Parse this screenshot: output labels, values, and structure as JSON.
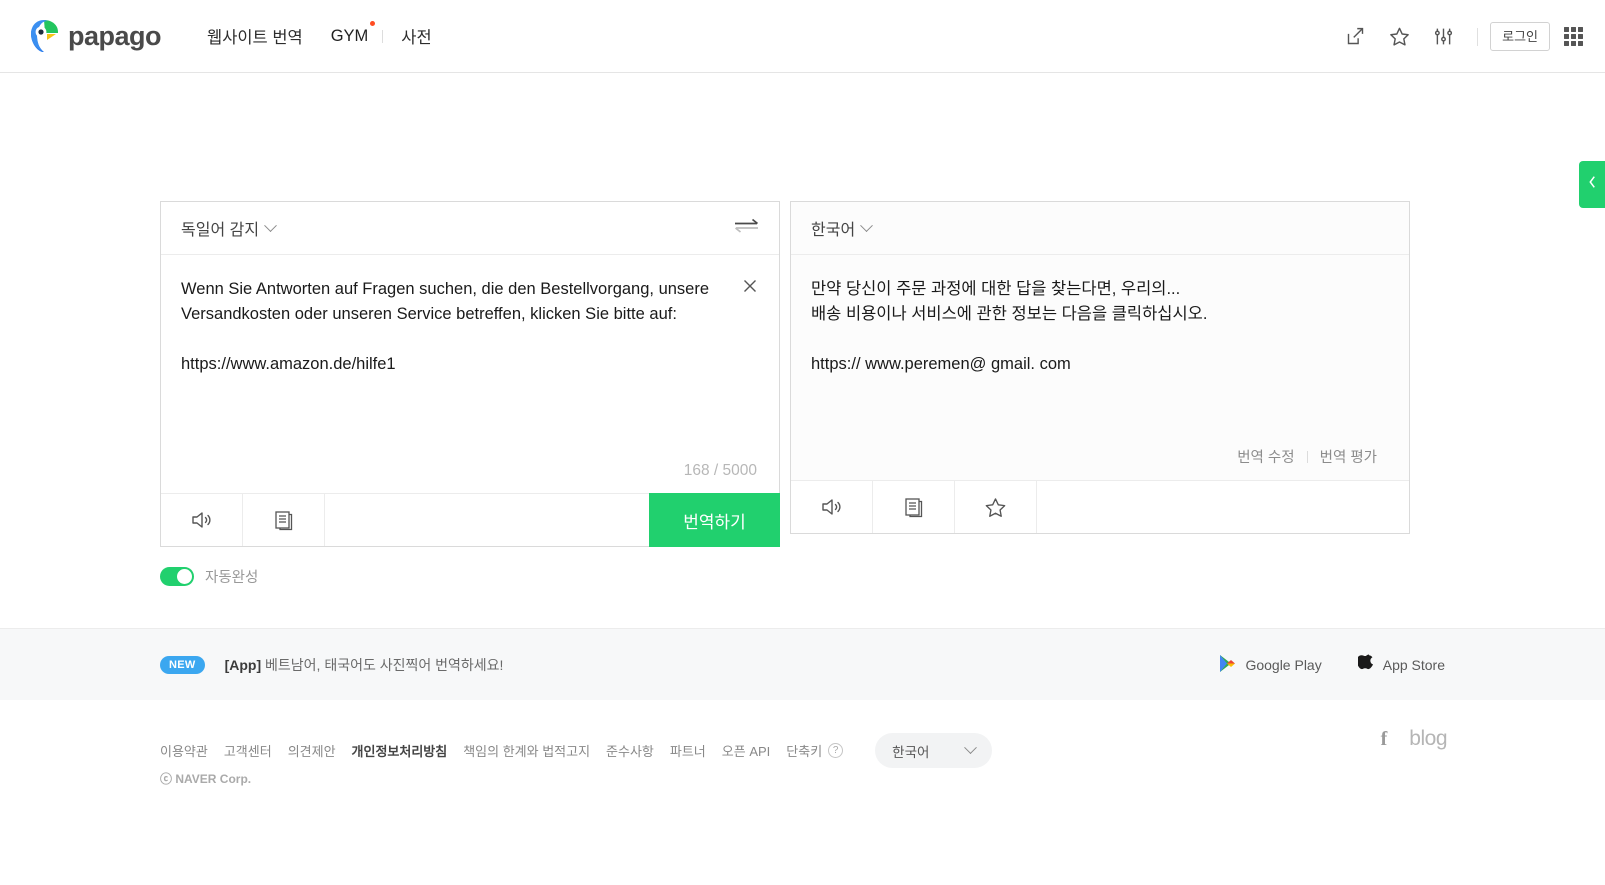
{
  "header": {
    "logo_text": "papago",
    "logo_icon": "papago-parrot-logo",
    "nav": [
      {
        "label": "웹사이트 번역",
        "name": "website-translate"
      },
      {
        "label": "GYM",
        "name": "gym"
      },
      {
        "label": "사전",
        "name": "dictionary"
      }
    ],
    "icons": [
      {
        "name": "share-icon"
      },
      {
        "name": "star-icon"
      },
      {
        "name": "settings-sliders-icon"
      }
    ],
    "login_label": "로그인",
    "apps_icon": "app-grid-icon"
  },
  "side_tab": {
    "icon": "chevron-left-icon",
    "color": "#21d06e"
  },
  "source_panel": {
    "language": "독일어 감지",
    "chevron_icon": "chevron-down-icon",
    "swap_icon": "swap-languages-icon",
    "clear_icon": "close-icon",
    "text": "Wenn Sie Antworten auf Fragen suchen, die den Bestellvorgang, unsere\nVersandkosten oder unseren Service betreffen, klicken Sie bitte auf:\n\nhttps://www.amazon.de/hilfe1",
    "counter": "168 / 5000",
    "char_count": 168,
    "char_limit": 5000,
    "tools": [
      {
        "name": "listen-icon"
      },
      {
        "name": "copy-icon"
      }
    ],
    "translate_label": "번역하기"
  },
  "target_panel": {
    "language": "한국어",
    "chevron_icon": "chevron-down-icon",
    "text": "만약 당신이 주문 과정에 대한 답을 찾는다면, 우리의...\n배송 비용이나 서비스에 관한 정보는 다음을 클릭하십시오.\n\nhttps:// www.peremen@ gmail. com",
    "actions": [
      {
        "label": "번역 수정",
        "name": "edit-translation"
      },
      {
        "label": "번역 평가",
        "name": "rate-translation"
      }
    ],
    "tools": [
      {
        "name": "listen-icon"
      },
      {
        "name": "copy-icon"
      },
      {
        "name": "favorite-star-icon"
      }
    ]
  },
  "autocomplete": {
    "label": "자동완성",
    "enabled": true
  },
  "footer_app": {
    "badge": "NEW",
    "title": "[App]",
    "text": "베트남어, 태국어도 사진찍어 번역하세요!",
    "stores": [
      {
        "label": "Google Play",
        "icon": "google-play-icon"
      },
      {
        "label": "App Store",
        "icon": "apple-icon"
      }
    ]
  },
  "footer": {
    "links": [
      {
        "label": "이용약관",
        "strong": false
      },
      {
        "label": "고객센터",
        "strong": false
      },
      {
        "label": "의견제안",
        "strong": false
      },
      {
        "label": "개인정보처리방침",
        "strong": true
      },
      {
        "label": "책임의 한계와 법적고지",
        "strong": false
      },
      {
        "label": "준수사항",
        "strong": false
      },
      {
        "label": "파트너",
        "strong": false
      },
      {
        "label": "오픈 API",
        "strong": false
      },
      {
        "label": "단축키",
        "strong": false
      }
    ],
    "help_icon": "question-mark-icon",
    "language": "한국어",
    "copyright": "ⓒ NAVER Corp.",
    "social": [
      {
        "label": "f",
        "name": "facebook-icon"
      },
      {
        "label": "blog",
        "name": "blog-icon"
      }
    ]
  },
  "colors": {
    "brand_green": "#21d06e",
    "badge_blue": "#3ba7f0",
    "dot_orange": "#ff4d22"
  }
}
